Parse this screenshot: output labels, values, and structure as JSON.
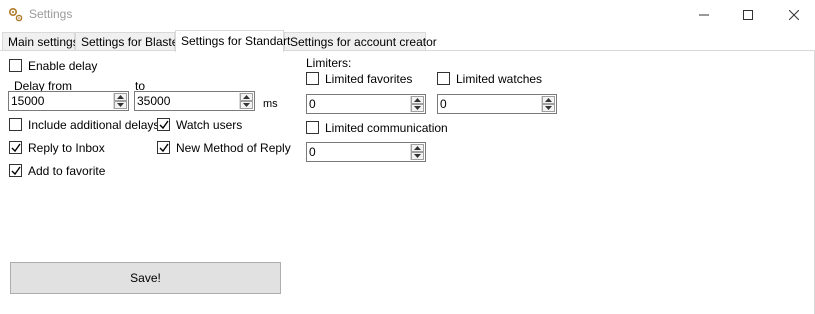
{
  "window": {
    "title": "Settings",
    "icon": "gear-icon",
    "controls": {
      "minimize": "minimize-icon",
      "maximize": "maximize-icon",
      "close": "close-icon"
    }
  },
  "tabs": [
    {
      "label": "Main settings",
      "active": false
    },
    {
      "label": "Settings for Blaster",
      "active": false
    },
    {
      "label": "Settings for Standart",
      "active": true
    },
    {
      "label": "Settings for account creator",
      "active": false
    }
  ],
  "delay": {
    "enable_label": "Enable delay",
    "enable_checked": false,
    "from_label": "Delay from",
    "from_value": "15000",
    "to_label": "to",
    "to_value": "35000",
    "unit": "ms"
  },
  "options": {
    "include_additional_delays": {
      "label": "Include additional delays",
      "checked": false
    },
    "watch_users": {
      "label": "Watch users",
      "checked": true
    },
    "reply_to_inbox": {
      "label": "Reply to Inbox",
      "checked": true
    },
    "new_method_of_reply": {
      "label": "New Method of Reply",
      "checked": true
    },
    "add_to_favorite": {
      "label": "Add to favorite",
      "checked": true
    }
  },
  "limiters": {
    "heading": "Limiters:",
    "favorites": {
      "label": "Limited favorites",
      "checked": false,
      "value": "0"
    },
    "watches": {
      "label": "Limited watches",
      "checked": false,
      "value": "0"
    },
    "communication": {
      "label": "Limited communication",
      "checked": false,
      "value": "0"
    }
  },
  "save_label": "Save!"
}
